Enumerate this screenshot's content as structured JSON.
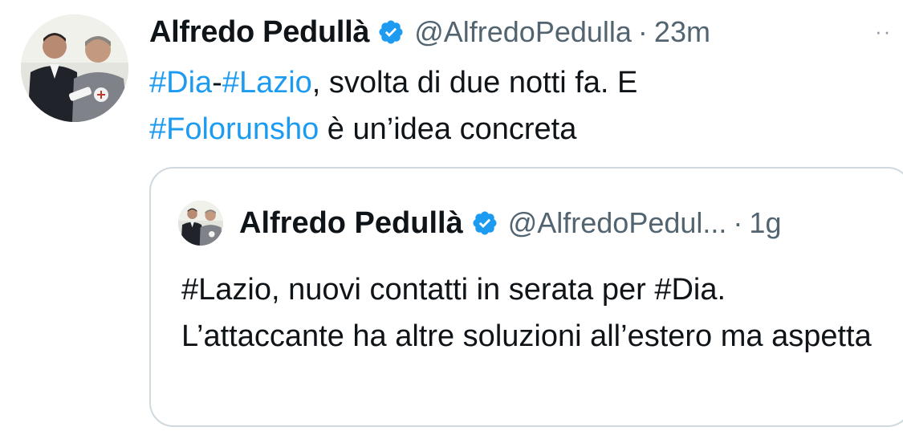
{
  "tweet": {
    "author_name": "Alfredo Pedullà",
    "handle": "@AlfredoPedulla",
    "separator": "·",
    "time": "23m",
    "more_label": "··",
    "text": {
      "tag1": "#Dia",
      "dash": "-",
      "tag2": "#Lazio",
      "part1": ", svolta di due notti fa. E ",
      "tag3": "#Folorunsho",
      "part2": " è un’idea concreta"
    }
  },
  "quoted_tweet": {
    "author_name": "Alfredo Pedullà",
    "handle": "@AlfredoPedul...",
    "separator": "·",
    "time": "1g",
    "text": "#Lazio, nuovi contatti in serata per #Dia. L’attaccante ha altre soluzioni all’estero ma aspetta"
  },
  "colors": {
    "link": "#1d9bf0",
    "verified": "#1d9bf0",
    "secondary_text": "#536471",
    "border": "#cfd9de"
  },
  "icons": {
    "verified": "verified-badge-icon",
    "more": "more-options-icon"
  }
}
